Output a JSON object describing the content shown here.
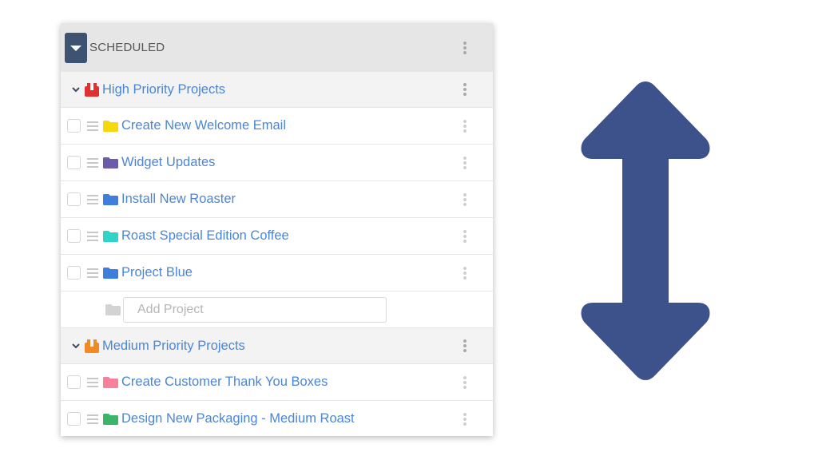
{
  "header": {
    "title": "SCHEDULED",
    "toggle_icon": "caret-down-icon",
    "menu_icon": "kebab-icon"
  },
  "groups": [
    {
      "title": "High Priority Projects",
      "icon_color": "#e03131",
      "projects": [
        {
          "title": "Create New Welcome Email",
          "folder_color": "#f5d90a"
        },
        {
          "title": "Widget Updates",
          "folder_color": "#6b5ba8"
        },
        {
          "title": "Install New Roaster",
          "folder_color": "#3f7fdc"
        },
        {
          "title": "Roast Special Edition Coffee",
          "folder_color": "#2dd4c8"
        },
        {
          "title": "Project Blue",
          "folder_color": "#3f7fdc"
        }
      ],
      "add_project_placeholder": "Add Project"
    },
    {
      "title": "Medium Priority Projects",
      "icon_color": "#f08a24",
      "projects": [
        {
          "title": "Create Customer Thank You Boxes",
          "folder_color": "#f7819a"
        },
        {
          "title": "Design New Packaging - Medium Roast",
          "folder_color": "#3bb56a"
        }
      ]
    }
  ],
  "colors": {
    "header_toggle": "#3e5272",
    "link": "#4a86d8",
    "arrow": "#3d528b"
  },
  "decoration": {
    "arrow_icon": "vertical-double-arrow-icon"
  }
}
